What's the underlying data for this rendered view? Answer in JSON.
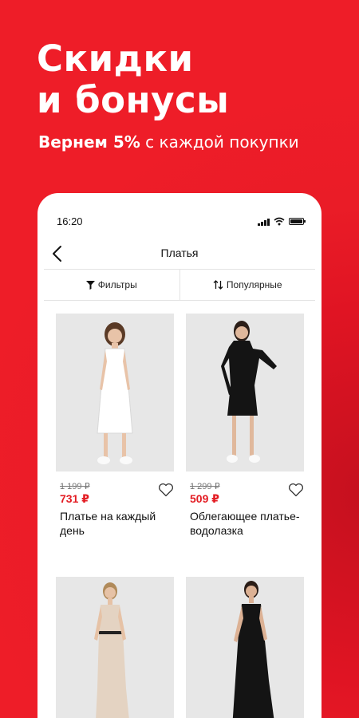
{
  "promo": {
    "headline_line1": "Скидки",
    "headline_line2": "и бонусы",
    "sub_bold": "Вернем 5%",
    "sub_rest": " с каждой покупки"
  },
  "status_bar": {
    "time": "16:20"
  },
  "nav": {
    "title": "Платья"
  },
  "toolbar": {
    "filters_label": "Фильтры",
    "sort_label": "Популярные"
  },
  "products": [
    {
      "old_price": "1 199 ₽",
      "price": "731 ₽",
      "name": "Платье на каждый день",
      "dress_color": "#ffffff"
    },
    {
      "old_price": "1 299 ₽",
      "price": "509 ₽",
      "name": "Облегающее платье-водолазка",
      "dress_color": "#141414"
    },
    {
      "dress_color": "#e4d3c2"
    },
    {
      "dress_color": "#141414"
    }
  ],
  "colors": {
    "accent": "#e31c23",
    "background_red": "#ee1d28"
  }
}
